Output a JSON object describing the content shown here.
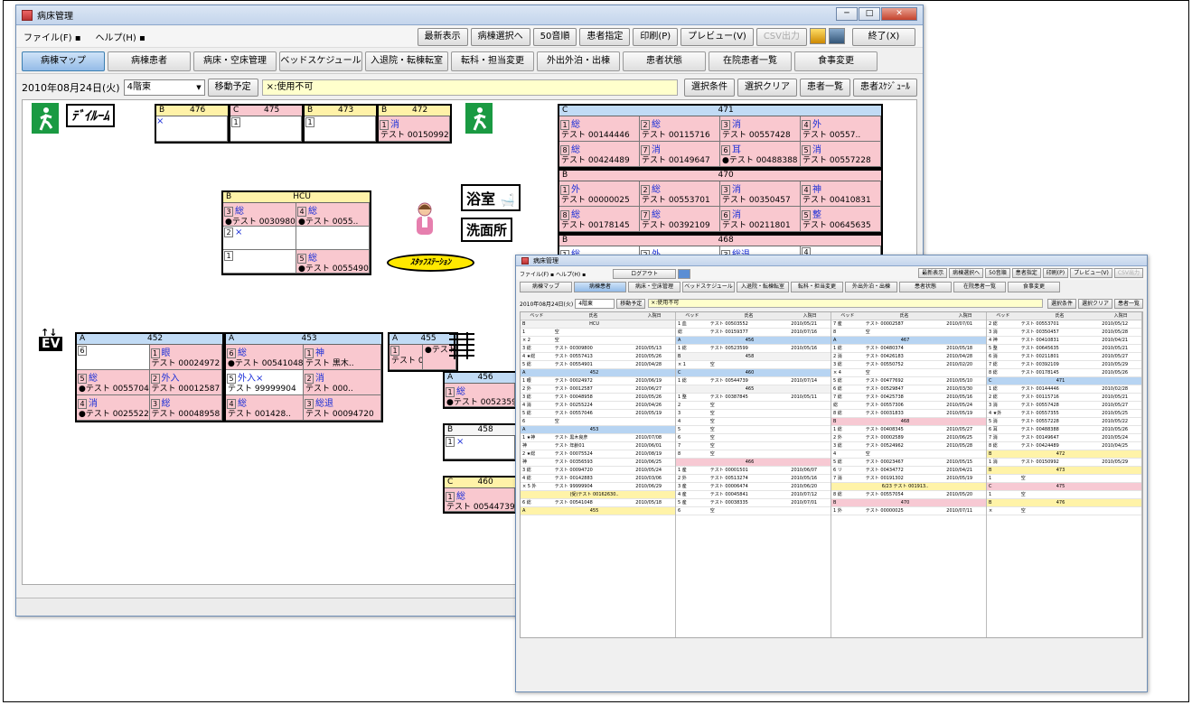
{
  "window": {
    "title": "病床管理"
  },
  "menu": [
    "ファイル(F) ▪",
    "ヘルプ(H) ▪"
  ],
  "toolbar": [
    "最新表示",
    "病棟選択へ",
    "50音順",
    "患者指定",
    "印刷(P)",
    "プレビュー(V)",
    "CSV出力",
    "終了(X)"
  ],
  "tabs": [
    "病棟マップ",
    "病棟患者",
    "病床・空床管理",
    "ベッドスケジュール",
    "入退院・転棟転室",
    "転科・担当変更",
    "外出外泊・出棟",
    "患者状態",
    "在院患者一覧",
    "食事変更"
  ],
  "date_bar": {
    "date": "2010年08月24日(火)",
    "floor": "4階東",
    "move_button": "移動予定",
    "note": "×:使用不可",
    "buttons": [
      "選択条件",
      "選択クリア",
      "患者一覧",
      "患者ｽｹｼﾞｭｰﾙ"
    ]
  },
  "labels": {
    "dayroom": "ﾃﾞｲﾙｰﾑ",
    "bath": "浴室",
    "washroom": "洗面所",
    "staff": "ｽﾀｯﾌｽﾃｰｼｮﾝ",
    "ev": "EV",
    "ev_arrows": "↑↓"
  },
  "top_rooms": [
    {
      "cls": "B",
      "no": "476",
      "beds": [
        {
          "n": "",
          "t": "×",
          "p": ""
        }
      ]
    },
    {
      "cls": "C",
      "no": "475",
      "beds": [
        {
          "n": "1",
          "t": "",
          "p": ""
        }
      ]
    },
    {
      "cls": "B",
      "no": "473",
      "beds": [
        {
          "n": "1",
          "t": "",
          "p": ""
        }
      ]
    },
    {
      "cls": "B",
      "no": "472",
      "beds": [
        {
          "n": "1",
          "t": "消",
          "p": "テスト 00150992"
        }
      ]
    }
  ],
  "hcu": {
    "cls": "B",
    "name": "HCU",
    "beds": [
      {
        "n": "3",
        "t": "総",
        "p": "●テスト 00309800"
      },
      {
        "n": "4",
        "t": "総",
        "p": "●テスト 0055.."
      },
      {
        "n": "2",
        "t": "×",
        "p": ""
      },
      {
        "n": "",
        "t": "",
        "p": ""
      },
      {
        "n": "1",
        "t": "",
        "p": ""
      },
      {
        "n": "5",
        "t": "総",
        "p": "●テスト 00554901"
      }
    ]
  },
  "right_rooms": [
    {
      "cls": "C",
      "no": "471",
      "beds": [
        {
          "n": "1",
          "t": "総",
          "p": "テスト 00144446"
        },
        {
          "n": "2",
          "t": "総",
          "p": "テスト 00115716"
        },
        {
          "n": "3",
          "t": "消",
          "p": "テスト 00557428"
        },
        {
          "n": "4",
          "t": "外",
          "p": "テスト 00557.."
        },
        {
          "n": "8",
          "t": "総",
          "p": "テスト 00424489"
        },
        {
          "n": "7",
          "t": "消",
          "p": "テスト 00149647"
        },
        {
          "n": "6",
          "t": "耳",
          "p": "●テスト 00488388"
        },
        {
          "n": "5",
          "t": "消",
          "p": "テスト 00557228"
        }
      ]
    },
    {
      "cls": "B",
      "no": "470",
      "beds": [
        {
          "n": "1",
          "t": "外",
          "p": "テスト 00000025"
        },
        {
          "n": "2",
          "t": "総",
          "p": "テスト 00553701"
        },
        {
          "n": "3",
          "t": "消",
          "p": "テスト 00350457"
        },
        {
          "n": "4",
          "t": "神",
          "p": "テスト 00410831"
        },
        {
          "n": "8",
          "t": "総",
          "p": "テスト 00178145"
        },
        {
          "n": "7",
          "t": "総",
          "p": "テスト 00392109"
        },
        {
          "n": "6",
          "t": "消",
          "p": "テスト 00211801"
        },
        {
          "n": "5",
          "t": "整",
          "p": "テスト 00645635"
        }
      ]
    },
    {
      "cls": "B",
      "no": "468",
      "beds": [
        {
          "n": "1",
          "t": "総",
          "p": ""
        },
        {
          "n": "2",
          "t": "外",
          "p": ""
        },
        {
          "n": "3",
          "t": "総退",
          "p": ""
        },
        {
          "n": "4",
          "t": "",
          "p": ""
        }
      ]
    }
  ],
  "bottom_rooms": [
    {
      "cls": "A",
      "no": "452",
      "beds": [
        {
          "n": "6",
          "t": "",
          "p": ""
        },
        {
          "n": "1",
          "t": "眼",
          "p": "テスト 00024972"
        },
        {
          "n": "5",
          "t": "総",
          "p": "●テスト 00557046"
        },
        {
          "n": "2",
          "t": "外入",
          "p": "テスト 00012587"
        },
        {
          "n": "4",
          "t": "消",
          "p": "●テスト 00255224"
        },
        {
          "n": "3",
          "t": "総",
          "p": "テスト 00048958"
        }
      ]
    },
    {
      "cls": "A",
      "no": "453",
      "beds": [
        {
          "n": "6",
          "t": "総",
          "p": "●テスト 00541048"
        },
        {
          "n": "1",
          "t": "神",
          "p": "テスト 黒木.."
        },
        {
          "n": "5",
          "t": "外入×",
          "p": "テスト 99999904"
        },
        {
          "n": "2",
          "t": "消",
          "p": "テスト 000.."
        },
        {
          "n": "4",
          "t": "総",
          "p": "テスト 001428.."
        },
        {
          "n": "3",
          "t": "総退",
          "p": "テスト 00094720"
        }
      ]
    },
    {
      "cls": "A",
      "no": "455",
      "beds": [
        {
          "n": "1",
          "t": "",
          "p": "テスト 001593.."
        },
        {
          "n": "",
          "t": "",
          "p": "●テスト 00503552"
        }
      ]
    }
  ],
  "mid_right_rooms": [
    {
      "cls": "A",
      "no": "456",
      "beds": [
        {
          "n": "1",
          "t": "総",
          "p": "●テスト 00523599"
        }
      ]
    },
    {
      "cls": "B",
      "no": "458",
      "beds": [
        {
          "n": "1",
          "t": "×",
          "p": ""
        }
      ]
    },
    {
      "cls": "C",
      "no": "460",
      "beds": [
        {
          "n": "1",
          "t": "総",
          "p": "テスト 00544739"
        }
      ]
    }
  ],
  "bed_hints": {
    "age": "テスト 年齢01"
  },
  "second_window": {
    "title": "病床管理",
    "menu": "ファイル(F) ▪ ヘルプ(H) ▪",
    "logout": "ログアウト",
    "toolbar": [
      "最新表示",
      "病棟選択へ",
      "50音順",
      "患者指定",
      "印刷(P)",
      "プレビュー(V)",
      "CSV出力"
    ],
    "tabs": [
      "病棟マップ",
      "病棟患者",
      "病床・空床管理",
      "ベッドスケジュール",
      "入退院・転棟転室",
      "転科・担当変更",
      "外出外泊・出棟",
      "患者状態",
      "在院患者一覧",
      "食事変更"
    ],
    "date": "2010年08月24日(火)",
    "floor": "4階東",
    "move_button": "移動予定",
    "note": "×:使用不可",
    "buttons": [
      "選択条件",
      "選択クリア",
      "患者一覧"
    ],
    "headers": [
      "ベッド",
      "氏名",
      "入院日"
    ],
    "columns": [
      [
        [
          "g",
          "B",
          "HCU",
          ""
        ],
        [
          "w",
          "1",
          "空",
          ""
        ],
        [
          "w",
          "× 2",
          "空",
          ""
        ],
        [
          "w",
          "3 総",
          "テスト 00309800",
          "2010/05/13"
        ],
        [
          "w",
          "4 ★総",
          "テスト 00557413",
          "2010/05/26"
        ],
        [
          "w",
          "5 総",
          "テスト 00554901",
          "2010/04/28"
        ],
        [
          "b",
          "A",
          "452",
          ""
        ],
        [
          "w",
          "1 眼",
          "テスト 00024972",
          "2010/06/19"
        ],
        [
          "w",
          "2 外",
          "テスト 00012587",
          "2010/06/27"
        ],
        [
          "w",
          "3 総",
          "テスト 00048958",
          "2010/05/26"
        ],
        [
          "w",
          "4 消",
          "テスト 00255224",
          "2010/04/26"
        ],
        [
          "w",
          "5 総",
          "テスト 00557046",
          "2010/05/19"
        ],
        [
          "w",
          "6",
          "空",
          ""
        ],
        [
          "b",
          "A",
          "453",
          ""
        ],
        [
          "w",
          "1 ★神",
          "テスト 黒木良彦",
          "2010/07/08"
        ],
        [
          "w",
          "神",
          "テスト 年齢01",
          "2010/06/01"
        ],
        [
          "w",
          "2 ★総",
          "テスト 00075524",
          "2010/08/19"
        ],
        [
          "w",
          "神",
          "テスト 00356593",
          "2010/06/25"
        ],
        [
          "w",
          "3 総",
          "テスト 00094720",
          "2010/05/24"
        ],
        [
          "w",
          "4 総",
          "テスト 00142883",
          "2010/03/06"
        ],
        [
          "w",
          "× 5 外",
          "テスト 99999904",
          "2010/06/29"
        ],
        [
          "y",
          "",
          "(受)テスト 00162630..",
          ""
        ],
        [
          "w",
          "6 総",
          "テスト 00541048",
          "2010/05/18"
        ],
        [
          "y",
          "A",
          "455",
          ""
        ]
      ],
      [
        [
          "w",
          "1 血",
          "テスト 00503552",
          "2010/05/21"
        ],
        [
          "w",
          "総",
          "テスト 00159377",
          "2010/07/16"
        ],
        [
          "b",
          "A",
          "456",
          ""
        ],
        [
          "w",
          "1 総",
          "テスト 00523599",
          "2010/05/16"
        ],
        [
          "g",
          "B",
          "458",
          ""
        ],
        [
          "w",
          "× 1",
          "空",
          ""
        ],
        [
          "b",
          "C",
          "460",
          ""
        ],
        [
          "w",
          "1 総",
          "テスト 00544739",
          "2010/07/14"
        ],
        [
          "g",
          "",
          "465",
          ""
        ],
        [
          "w",
          "1 整",
          "テスト 00387845",
          "2010/05/11"
        ],
        [
          "w",
          "2",
          "空",
          ""
        ],
        [
          "w",
          "3",
          "空",
          ""
        ],
        [
          "w",
          "4",
          "空",
          ""
        ],
        [
          "w",
          "5",
          "空",
          ""
        ],
        [
          "w",
          "6",
          "空",
          ""
        ],
        [
          "w",
          "7",
          "空",
          ""
        ],
        [
          "w",
          "8",
          "空",
          ""
        ],
        [
          "p",
          "",
          "466",
          ""
        ],
        [
          "w",
          "1 産",
          "テスト 00001501",
          "2010/06/07"
        ],
        [
          "w",
          "2 外",
          "テスト 00513274",
          "2010/05/16"
        ],
        [
          "w",
          "3 産",
          "テスト 00006474",
          "2010/06/20"
        ],
        [
          "w",
          "4 産",
          "テスト 00045841",
          "2010/07/12"
        ],
        [
          "w",
          "5 産",
          "テスト 00038335",
          "2010/07/01"
        ],
        [
          "w",
          "6",
          "空",
          ""
        ]
      ],
      [
        [
          "w",
          "7 産",
          "テスト 00002587",
          "2010/07/01"
        ],
        [
          "w",
          "8",
          "空",
          ""
        ],
        [
          "b",
          "A",
          "467",
          ""
        ],
        [
          "w",
          "1 総",
          "テスト 00480374",
          "2010/05/18"
        ],
        [
          "w",
          "2 消",
          "テスト 00426183",
          "2010/04/28"
        ],
        [
          "w",
          "3 総",
          "テスト 00550752",
          "2010/02/20"
        ],
        [
          "w",
          "× 4",
          "空",
          ""
        ],
        [
          "w",
          "5 総",
          "テスト 00477692",
          "2010/05/10"
        ],
        [
          "w",
          "6 総",
          "テスト 00529847",
          "2010/03/30"
        ],
        [
          "w",
          "7 総",
          "テスト 00425738",
          "2010/05/16"
        ],
        [
          "w",
          "総",
          "テスト 00557306",
          "2010/05/24"
        ],
        [
          "w",
          "8 総",
          "テスト 00031833",
          "2010/05/19"
        ],
        [
          "p",
          "B",
          "468",
          ""
        ],
        [
          "w",
          "1 総",
          "テスト 00408345",
          "2010/05/27"
        ],
        [
          "w",
          "2 外",
          "テスト 00002589",
          "2010/06/25"
        ],
        [
          "w",
          "3 総",
          "テスト 00524962",
          "2010/05/28"
        ],
        [
          "w",
          "4",
          "空",
          ""
        ],
        [
          "w",
          "5 総",
          "テスト 00023467",
          "2010/05/15"
        ],
        [
          "w",
          "6 リ",
          "テスト 00434772",
          "2010/04/21"
        ],
        [
          "w",
          "7 消",
          "テスト 00191302",
          "2010/05/19"
        ],
        [
          "y",
          "",
          "6/23 テスト 001913..",
          ""
        ],
        [
          "w",
          "8 総",
          "テスト 00557054",
          "2010/05/20"
        ],
        [
          "p",
          "B",
          "470",
          ""
        ],
        [
          "w",
          "1 外",
          "テスト 00000025",
          "2010/07/11"
        ]
      ],
      [
        [
          "w",
          "2 総",
          "テスト 00553701",
          "2010/05/12"
        ],
        [
          "w",
          "3 消",
          "テスト 00350457",
          "2010/05/28"
        ],
        [
          "w",
          "4 神",
          "テスト 00410831",
          "2010/04/21"
        ],
        [
          "w",
          "5 整",
          "テスト 00645635",
          "2010/05/21"
        ],
        [
          "w",
          "6 消",
          "テスト 00211801",
          "2010/05/27"
        ],
        [
          "w",
          "7 総",
          "テスト 00392109",
          "2010/05/29"
        ],
        [
          "w",
          "8 総",
          "テスト 00178145",
          "2010/05/26"
        ],
        [
          "b",
          "C",
          "471",
          ""
        ],
        [
          "w",
          "1 総",
          "テスト 00144446",
          "2010/02/28"
        ],
        [
          "w",
          "2 総",
          "テスト 00115716",
          "2010/05/21"
        ],
        [
          "w",
          "3 消",
          "テスト 00557428",
          "2010/05/27"
        ],
        [
          "w",
          "4 ★外",
          "テスト 00557355",
          "2010/05/25"
        ],
        [
          "w",
          "5 消",
          "テスト 00557228",
          "2010/05/22"
        ],
        [
          "w",
          "6 耳",
          "テスト 00488388",
          "2010/05/26"
        ],
        [
          "w",
          "7 消",
          "テスト 00149647",
          "2010/05/24"
        ],
        [
          "w",
          "8 総",
          "テスト 00424489",
          "2010/04/25"
        ],
        [
          "y",
          "B",
          "472",
          ""
        ],
        [
          "w",
          "1 消",
          "テスト 00150992",
          "2010/05/29"
        ],
        [
          "y",
          "B",
          "473",
          ""
        ],
        [
          "w",
          "1",
          "空",
          ""
        ],
        [
          "p",
          "C",
          "475",
          ""
        ],
        [
          "w",
          "1",
          "空",
          ""
        ],
        [
          "y",
          "B",
          "476",
          ""
        ],
        [
          "w",
          "× ",
          "空",
          ""
        ]
      ]
    ]
  }
}
